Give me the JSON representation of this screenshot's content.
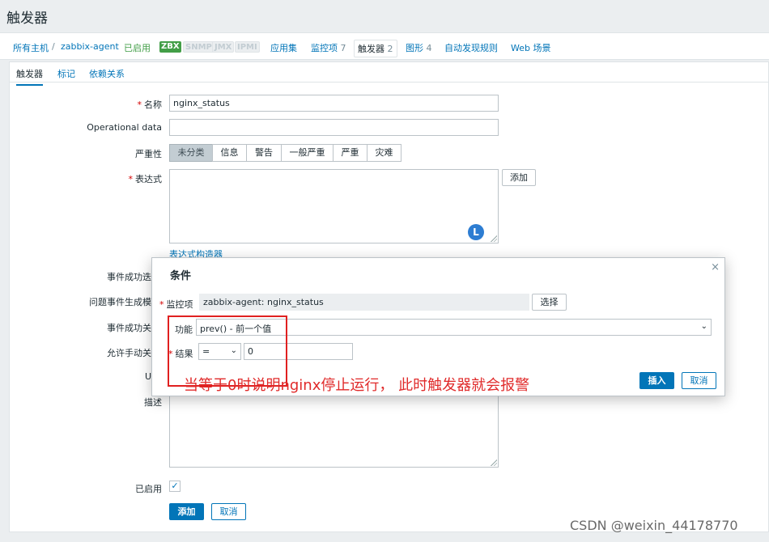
{
  "page": {
    "title": "触发器"
  },
  "breadcrumb": {
    "all_hosts": "所有主机",
    "separator": "/",
    "host": "zabbix-agent",
    "status": "已启用",
    "availability": [
      "ZBX",
      "SNMP",
      "JMX",
      "IPMI"
    ],
    "items": [
      {
        "label": "应用集",
        "count": ""
      },
      {
        "label": "监控项",
        "count": "7"
      },
      {
        "label": "触发器",
        "count": "2"
      },
      {
        "label": "图形",
        "count": "4"
      },
      {
        "label": "自动发现规则",
        "count": ""
      },
      {
        "label": "Web 场景",
        "count": ""
      }
    ]
  },
  "tabs": [
    "触发器",
    "标记",
    "依赖关系"
  ],
  "form": {
    "name_label": "名称",
    "name_value": "nginx_status",
    "opdata_label": "Operational data",
    "opdata_value": "",
    "severity_label": "严重性",
    "severity_options": [
      "未分类",
      "信息",
      "警告",
      "一般严重",
      "严重",
      "灾难"
    ],
    "severity_selected": "未分类",
    "expression_label": "表达式",
    "add_label": "添加",
    "expr_builder_link": "表达式构造器",
    "badge_letter": "L",
    "hidden_labels": [
      "事件成功迭",
      "问题事件生成模",
      "事件成功关",
      "允许手动关",
      "U",
      "描述"
    ],
    "enabled_label": "已启用",
    "enabled_mark": "✓",
    "submit_label": "添加",
    "cancel_label": "取消"
  },
  "dialog": {
    "title": "条件",
    "close": "×",
    "item_label": "监控项",
    "item_value": "zabbix-agent: nginx_status",
    "select_button": "选择",
    "function_label": "功能",
    "function_value": "prev() - 前一个值",
    "result_label": "结果",
    "operator_value": "=",
    "result_value": "0",
    "insert_button": "插入",
    "cancel_button": "取消"
  },
  "annotation": "当等于0时说明nginx停止运行， 此时触发器就会报警",
  "watermark": "CSDN @weixin_44178770",
  "colors": {
    "accent": "#0275b8",
    "enabled": "#429e47",
    "annotation": "#e02a2a"
  }
}
